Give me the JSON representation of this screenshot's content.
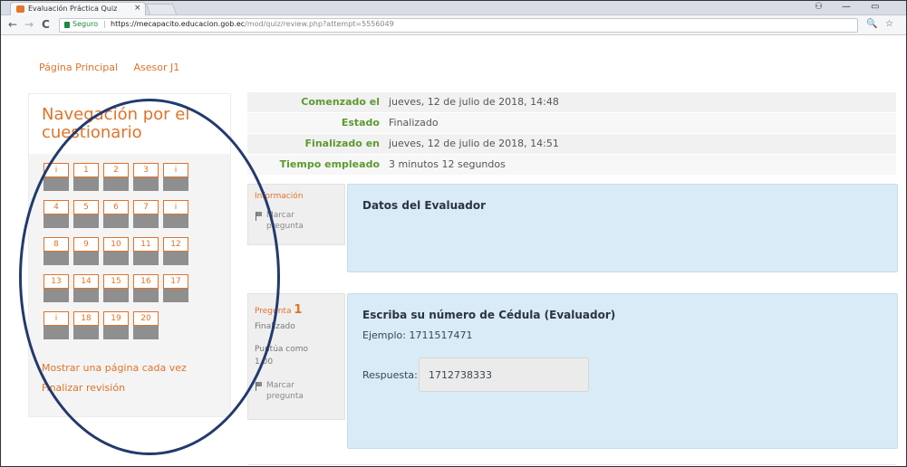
{
  "browser": {
    "tab_title": "Evaluación Práctica Quiz",
    "tab_close": "×",
    "minimize": "—",
    "restore": "▭",
    "back": "←",
    "forward": "→",
    "reload": "C",
    "secure_label": "Seguro",
    "separator": "|",
    "url_host": "https://mecapacito.educacion.gob.ec",
    "url_path": "/mod/quiz/review.php?attempt=5556049",
    "zoom_icon": "🔍",
    "star_icon": "☆"
  },
  "breadcrumb": [
    "Página Principal",
    "Asesor J1"
  ],
  "navigation": {
    "title": "Navegación por el cuestionario",
    "buttons": [
      "i",
      "1",
      "2",
      "3",
      "i",
      "4",
      "5",
      "6",
      "7",
      "i",
      "8",
      "9",
      "10",
      "11",
      "12",
      "13",
      "14",
      "15",
      "16",
      "17",
      "i",
      "18",
      "19",
      "20"
    ],
    "show_one_page": "Mostrar una página cada vez",
    "finish_review": "Finalizar revisión"
  },
  "summary": [
    {
      "label": "Comenzado el",
      "value": "jueves, 12 de julio de 2018, 14:48"
    },
    {
      "label": "Estado",
      "value": "Finalizado"
    },
    {
      "label": "Finalizado en",
      "value": "jueves, 12 de julio de 2018, 14:51"
    },
    {
      "label": "Tiempo empleado",
      "value": "3 minutos 12 segundos"
    }
  ],
  "info_block": {
    "label": "Información",
    "flag_line1": "Marcar",
    "flag_line2": "pregunta",
    "content_title": "Datos del Evaluador"
  },
  "question_1": {
    "label": "Pregunta",
    "number": "1",
    "status": "Finalizado",
    "score_line1": "Puntúa como",
    "score_line2": "1,00",
    "flag_line1": "Marcar",
    "flag_line2": "pregunta",
    "title": "Escriba su número de Cédula (Evaluador)",
    "example": "Ejemplo: 1711517471",
    "answer_label": "Respuesta:",
    "answer_value": "1712738333"
  },
  "colors": {
    "accent": "#e0732a",
    "label_green": "#5d9a2f",
    "question_bg": "#d9ebf6",
    "annotation_circle": "#223a6d"
  }
}
